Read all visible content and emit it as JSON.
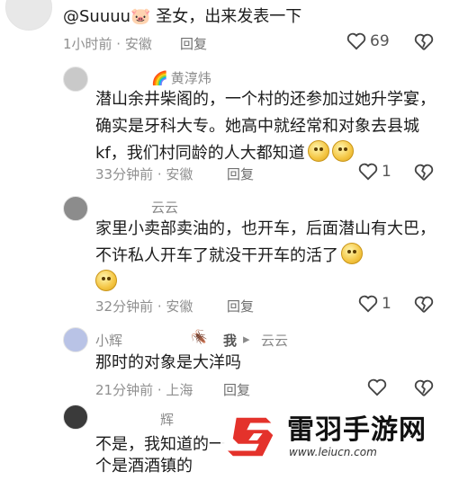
{
  "comments": [
    {
      "text": "@Suuuu🐷 圣女，出来发表一下",
      "meta": "1小时前 · 安徽",
      "reply": "回复",
      "likes": "69"
    },
    {
      "name_prefix": "🌈",
      "name": "黄淳炜",
      "text": "潜山余井柴阁的，一个村的还参加过她升学宴，确实是牙科大专。她高中就经常和对象去县城kf，我们村同龄的人大都知道",
      "meta": "33分钟前 · 安徽",
      "reply": "回复",
      "likes": "1"
    },
    {
      "name": "云云",
      "text": "家里小卖部卖油的，也开车，后面潜山有大巴，不许私人开车了就没干开车的活了",
      "meta": "32分钟前 · 安徽",
      "reply": "回复",
      "likes": "1"
    },
    {
      "name": "小辉",
      "bug": "🪳",
      "reply_tag": "我",
      "reply_target": "云云",
      "text": "那时的对象是大洋吗",
      "meta": "21分钟前 · 上海",
      "reply": "回复",
      "likes": ""
    },
    {
      "name": "辉",
      "text": "不是，我知道的一",
      "text2": "个是酒酒镇的"
    }
  ],
  "watermark": {
    "title": "雷羽手游网",
    "url": "www.leiucn.com"
  },
  "icons": {
    "like": "heart-outline-icon",
    "dislike": "broken-heart-icon",
    "accent": "#e4322b"
  }
}
